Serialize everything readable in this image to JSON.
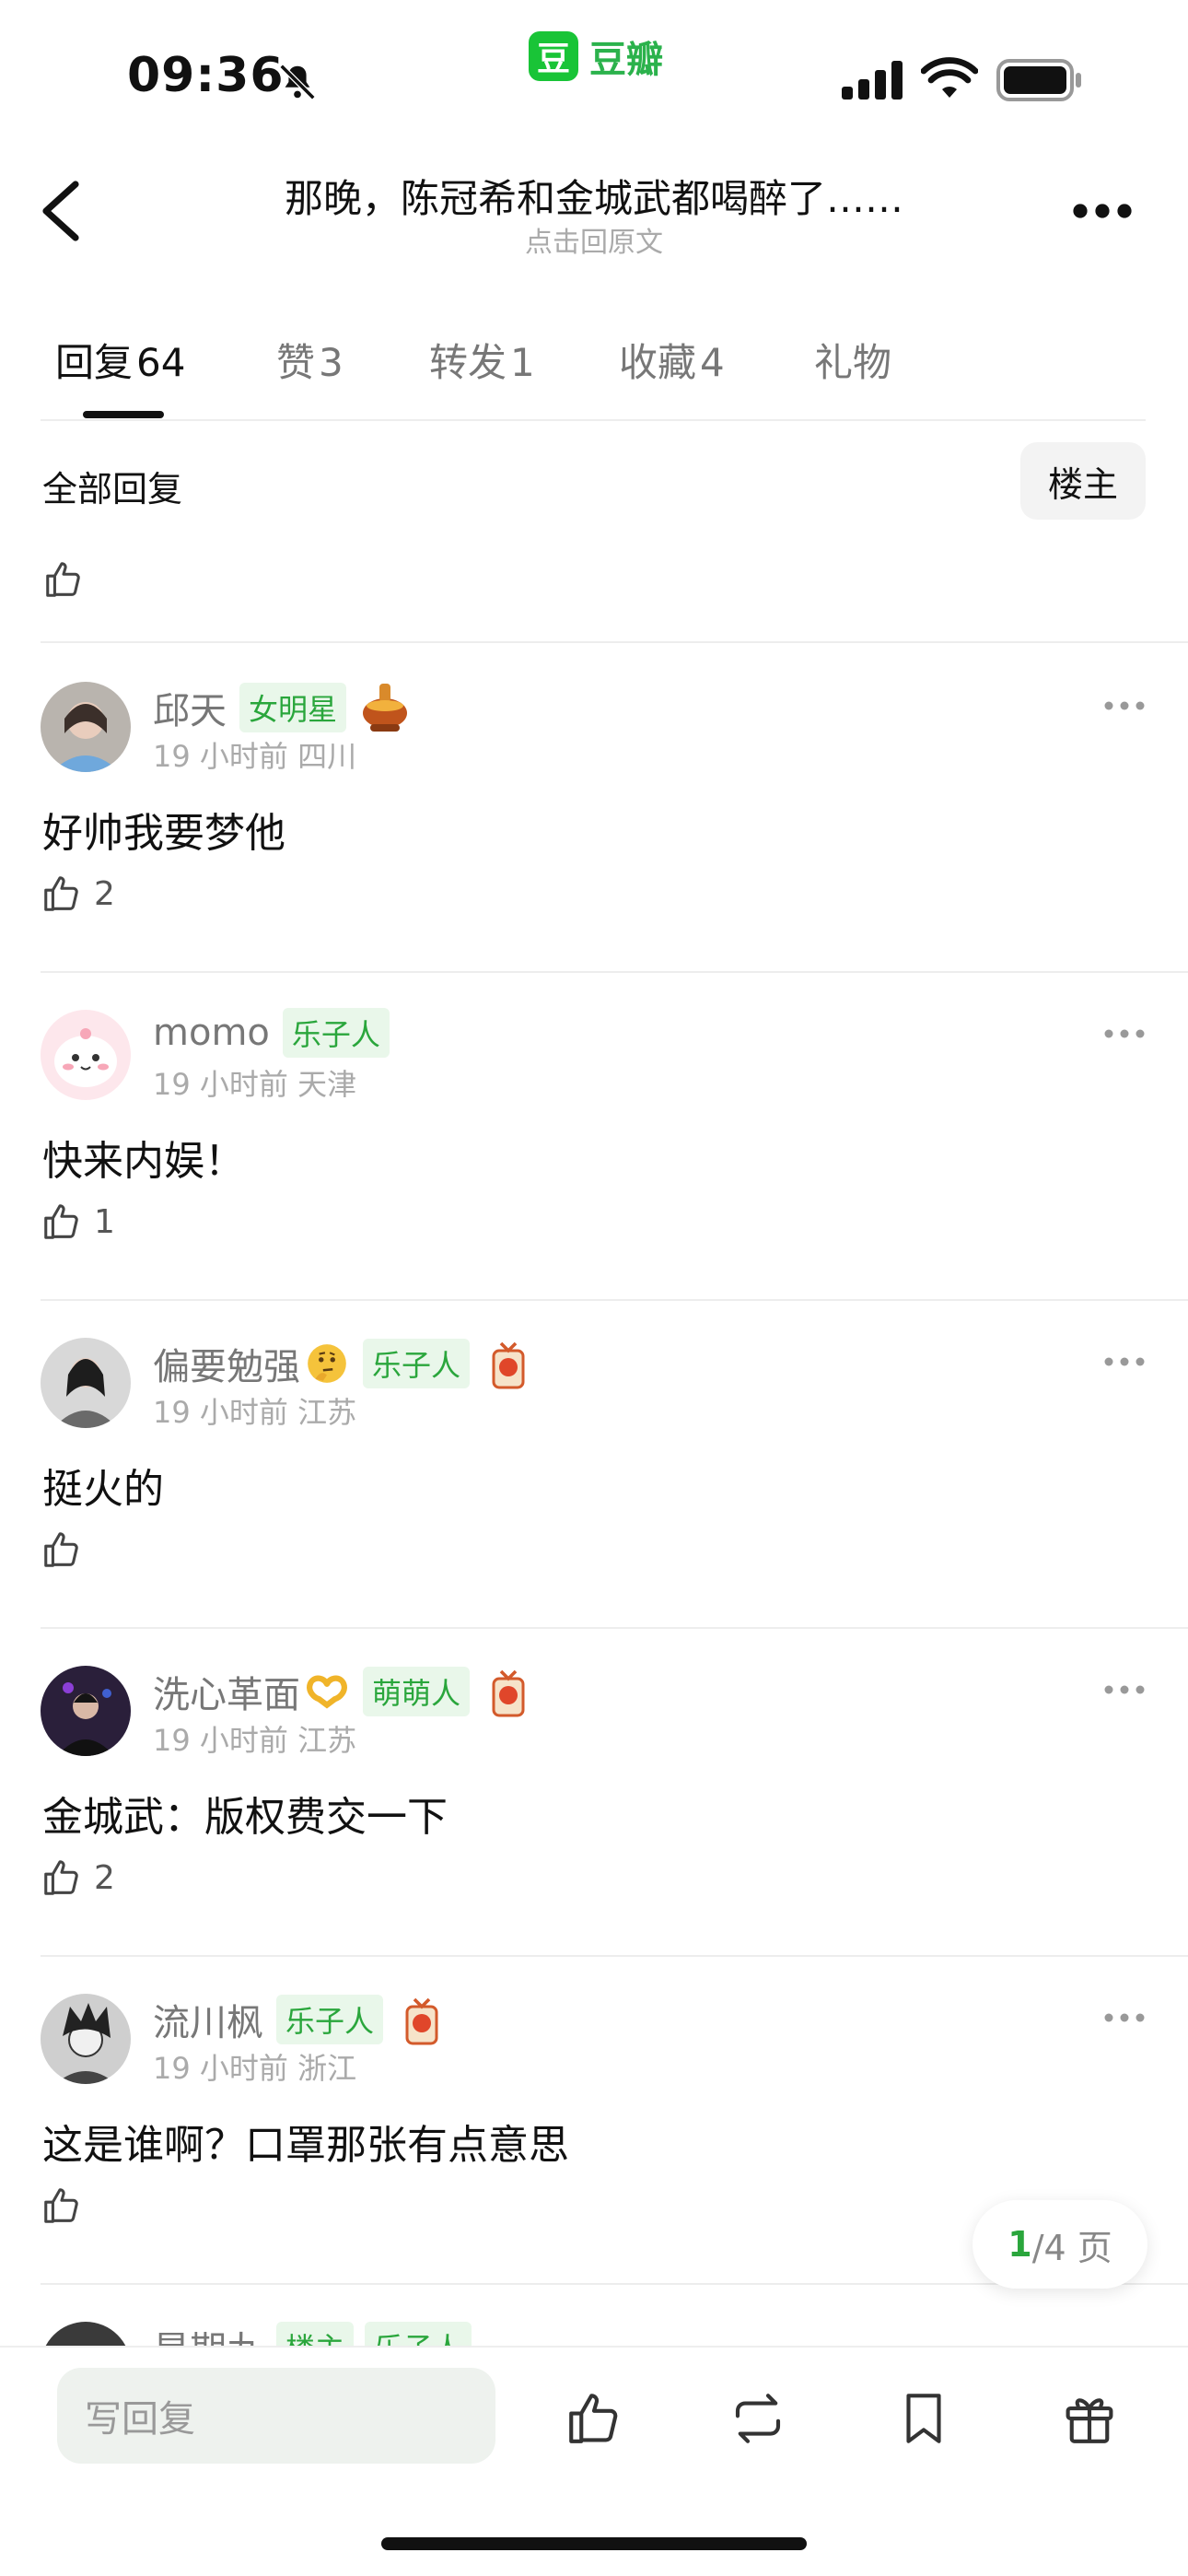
{
  "status_bar": {
    "time": "09:36",
    "app_logo_char": "豆",
    "app_name": "豆瓣"
  },
  "nav": {
    "title": "那晚，陈冠希和金城武都喝醉了……",
    "subtitle": "点击回原文"
  },
  "tabs": [
    {
      "label": "回复",
      "count": "64",
      "active": true
    },
    {
      "label": "赞",
      "count": "3"
    },
    {
      "label": "转发",
      "count": "1"
    },
    {
      "label": "收藏",
      "count": "4"
    },
    {
      "label": "礼物",
      "count": ""
    }
  ],
  "section": {
    "title": "全部回复",
    "filter_button": "楼主"
  },
  "comments": [
    {
      "name": "邱天",
      "badges": [
        "女明星"
      ],
      "time": "19 小时前",
      "location": "四川",
      "text": "好帅我要梦他",
      "likes": "2"
    },
    {
      "name": "momo",
      "badges": [
        "乐子人"
      ],
      "time": "19 小时前",
      "location": "天津",
      "text": "快来内娱！",
      "likes": "1"
    },
    {
      "name": "偏要勉强",
      "badges": [
        "乐子人"
      ],
      "time": "19 小时前",
      "location": "江苏",
      "text": "挺火的",
      "likes": ""
    },
    {
      "name": "洗心革面",
      "badges": [
        "萌萌人"
      ],
      "time": "19 小时前",
      "location": "江苏",
      "text": "金城武：版权费交一下",
      "likes": "2"
    },
    {
      "name": "流川枫",
      "badges": [
        "乐子人"
      ],
      "time": "19 小时前",
      "location": "浙江",
      "text": "这是谁啊？口罩那张有点意思",
      "likes": ""
    },
    {
      "name": "星期九",
      "badges": [
        "楼主",
        "乐子人"
      ],
      "time": "",
      "location": "",
      "text": "",
      "likes": ""
    }
  ],
  "pager": {
    "current": "1",
    "total": "/4 页"
  },
  "bottom_bar": {
    "reply_placeholder": "写回复"
  },
  "colors": {
    "accent": "#2aa63c",
    "brand": "#19c437",
    "badge_bg": "#e9f7ea"
  }
}
